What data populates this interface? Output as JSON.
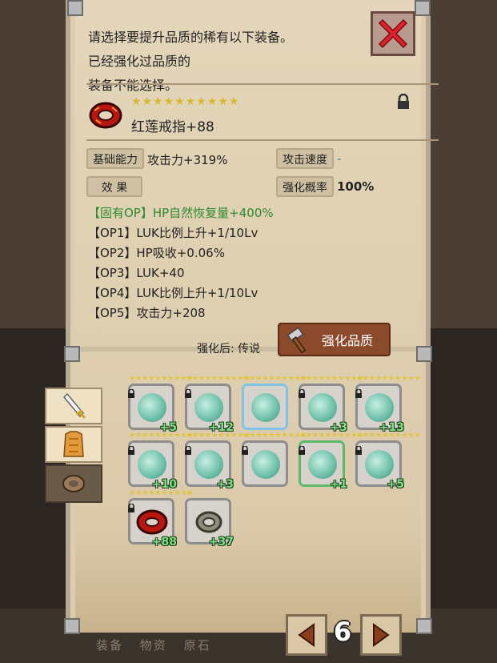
{
  "header": {
    "message_line1": "请选择要提升品质的稀有以下装备。",
    "message_line2": "已经强化过品质的",
    "message_line3": "装备不能选择。"
  },
  "item": {
    "stars": "★★★★★★★★★★",
    "name": "红莲戒指+88",
    "icon": "red-ring-icon"
  },
  "stats": {
    "base_label": "基础能力",
    "base_value": "攻击力+319%",
    "speed_label": "攻击速度",
    "speed_value": "-",
    "effect_label": "效 果",
    "rate_label": "强化概率",
    "rate_value": "100%"
  },
  "ops": [
    {
      "tag": "【固有OP】",
      "text": "HP自然恢复量+400%"
    },
    {
      "tag": "【OP1】",
      "text": "LUK比例上升+1/10Lv"
    },
    {
      "tag": "【OP2】",
      "text": "HP吸收+0.06%"
    },
    {
      "tag": "【OP3】",
      "text": "LUK+40"
    },
    {
      "tag": "【OP4】",
      "text": "LUK比例上升+1/10Lv"
    },
    {
      "tag": "【OP5】",
      "text": "攻击力+208"
    }
  ],
  "enhance": {
    "after_label": "强化后: 传说",
    "button_label": "强化品质"
  },
  "side_tabs": [
    "sword-icon",
    "armor-icon",
    "ring-icon"
  ],
  "inventory": [
    {
      "stars": "★★★★★★★★★★",
      "level": "+5",
      "type": "orb",
      "locked": true
    },
    {
      "stars": "★★★★★★★★★★",
      "level": "+12",
      "type": "orb",
      "locked": true
    },
    {
      "stars": "★★★★★★★★★★",
      "level": "",
      "type": "orb",
      "locked": false
    },
    {
      "stars": "★★★★★★★★★★",
      "level": "+3",
      "type": "orb",
      "locked": true
    },
    {
      "stars": "★★★★★★★★★★",
      "level": "+13",
      "type": "orb",
      "locked": true
    },
    {
      "stars": "★★★★★★★★★★",
      "level": "+10",
      "type": "orb",
      "locked": true
    },
    {
      "stars": "★★★★★★★★★★",
      "level": "+3",
      "type": "orb",
      "locked": true
    },
    {
      "stars": "★★★★★★★★★★",
      "level": "",
      "type": "orb",
      "locked": true
    },
    {
      "stars": "★★★★★★★★★★",
      "level": "+1",
      "type": "orb",
      "locked": true
    },
    {
      "stars": "★★★★★★★★★★",
      "level": "+5",
      "type": "orb",
      "locked": true
    },
    {
      "stars": "★★★★★★★★★★",
      "level": "+88",
      "type": "red-ring",
      "locked": true
    },
    {
      "stars": "★",
      "level": "+37",
      "type": "silver-ring",
      "locked": false
    }
  ],
  "pager": {
    "page": "6"
  },
  "bottom_tabs": [
    "装备",
    "物资",
    "原石"
  ],
  "colors": {
    "panel": "#dccdb0",
    "accent_green": "#7ee27e",
    "button_brown": "#8c4a2d"
  }
}
